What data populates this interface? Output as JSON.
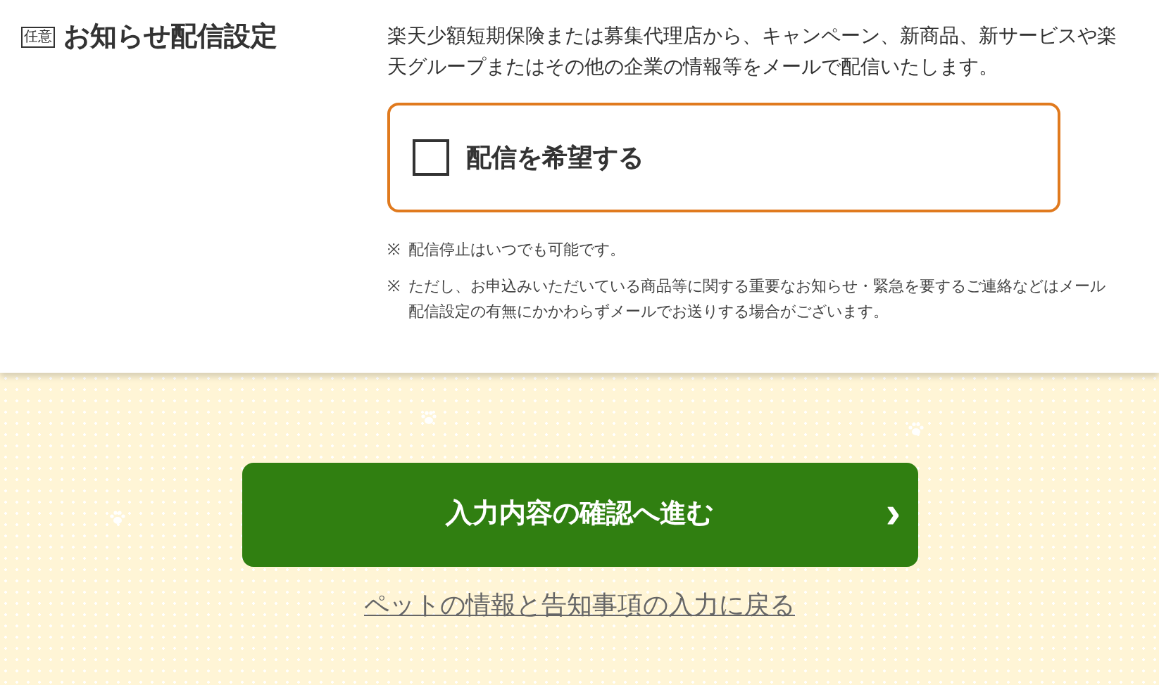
{
  "section": {
    "badge": "任意",
    "title": "お知らせ配信設定",
    "description": "楽天少額短期保険または募集代理店から、キャンペーン、新商品、新サービスや楽天グループまたはその他の企業の情報等をメールで配信いたします。",
    "option": {
      "label": "配信を希望する",
      "checked": false
    },
    "notes": [
      {
        "mark": "※",
        "text": "配信停止はいつでも可能です。"
      },
      {
        "mark": "※",
        "text": "ただし、お申込みいただいている商品等に関する重要なお知らせ・緊急を要するご連絡などはメール配信設定の有無にかかわらずメールでお送りする場合がございます。"
      }
    ]
  },
  "footer": {
    "next_button": {
      "label": "入力内容の確認へ進む",
      "arrow": "›"
    },
    "back_link": "ペットの情報と告知事項の入力に戻る"
  }
}
